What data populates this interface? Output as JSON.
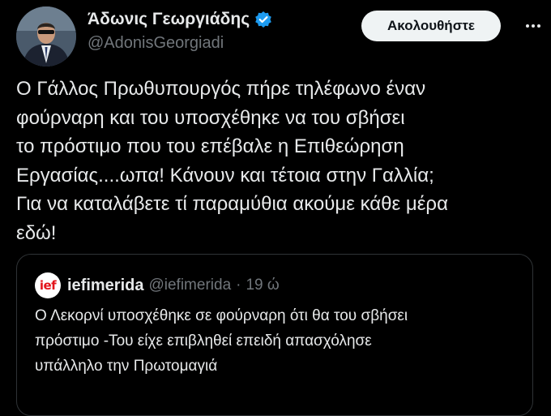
{
  "author": {
    "display_name": "Άδωνις Γεωργιάδης",
    "handle": "@AdonisGeorgiadi",
    "verified_icon": "verified-badge-icon"
  },
  "actions": {
    "follow_label": "Ακολουθήστε",
    "more_icon": "more-dots-icon"
  },
  "tweet": {
    "lines": [
      "Ο Γάλλος Πρωθυπουργός πήρε τηλέφωνο έναν",
      "φούρναρη και του υποσχέθηκε να του σβήσει",
      "το πρόστιμο που του επέβαλε η Επιθεώρηση",
      "Εργασίας....ωπα! Κάνουν και τέτοια στην Γαλλία;",
      "Για να καταλάβετε τί παραμύθια ακούμε κάθε μέρα",
      "εδώ!"
    ]
  },
  "quote": {
    "logo_text": "ief",
    "name": "iefimerida",
    "handle": "@iefimerida",
    "separator": "·",
    "time": "19 ώ",
    "lines": [
      "Ο Λεκορνί υποσχέθηκε σε φούρναρη ότι θα του σβήσει",
      "πρόστιμο -Του είχε επιβληθεί επειδή απασχόλησε",
      "υπάλληλο την Πρωτομαγιά"
    ]
  },
  "colors": {
    "background": "#000000",
    "text_primary": "#e7e9ea",
    "text_secondary": "#71767b",
    "verified_blue": "#1d9bf0",
    "border": "#2f3336",
    "logo_red": "#e3141b"
  }
}
